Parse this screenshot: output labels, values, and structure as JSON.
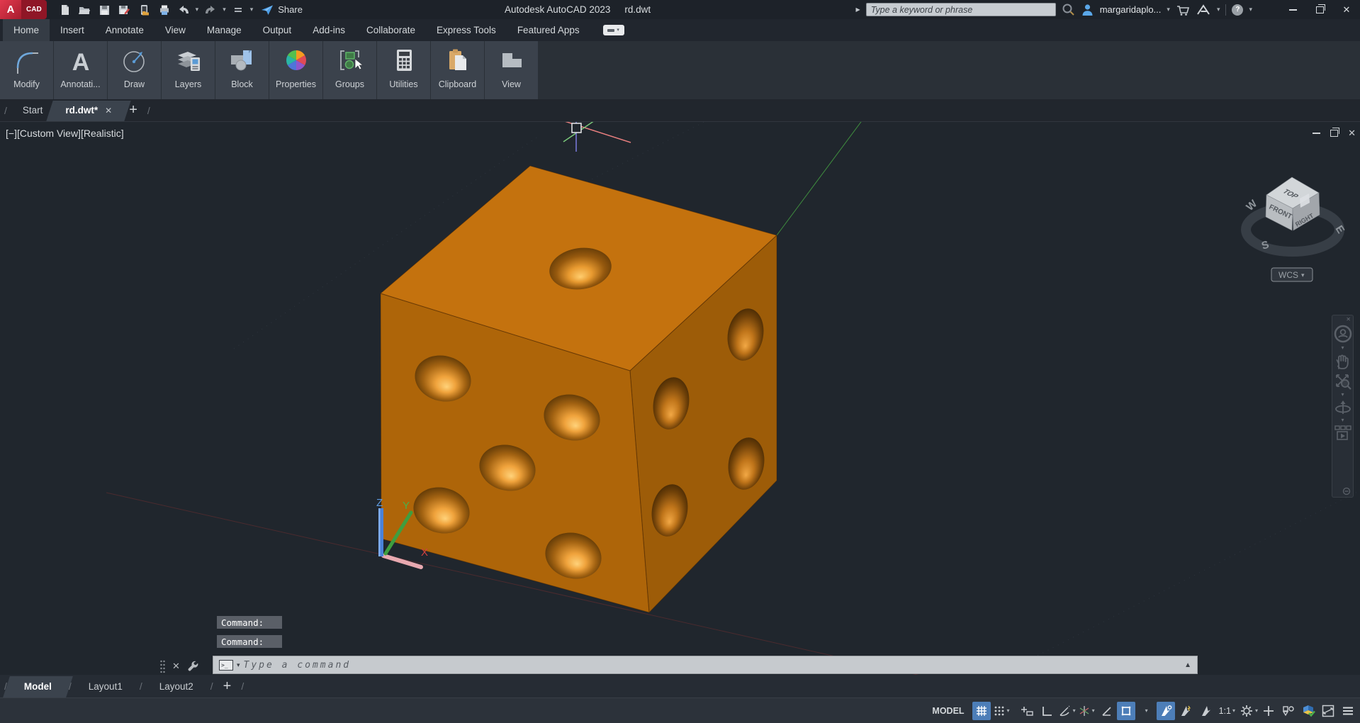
{
  "colors": {
    "accent_blue": "#4d7eb8",
    "logo_red": "#c21b2f",
    "dice_top": "#c4720e",
    "dice_front": "#ae6509",
    "dice_right": "#9d5c08",
    "canvas_bg": "#20262d",
    "command_bar_bg": "#c6cace",
    "viewcube_gray": "#c9cdd0"
  },
  "title_bar": {
    "logo_a": "A",
    "logo_cad": "CAD",
    "share_label": "Share",
    "app_title": "Autodesk AutoCAD 2023",
    "doc_title": "rd.dwt",
    "search_placeholder": "Type a keyword or phrase",
    "username": "margaridaplo...",
    "help_q": "?"
  },
  "menu": {
    "items": [
      "Home",
      "Insert",
      "Annotate",
      "View",
      "Manage",
      "Output",
      "Add-ins",
      "Collaborate",
      "Express Tools",
      "Featured Apps"
    ]
  },
  "ribbon": {
    "panels": [
      {
        "label": "Modify"
      },
      {
        "label": "Annotati..."
      },
      {
        "label": "Draw"
      },
      {
        "label": "Layers"
      },
      {
        "label": "Block"
      },
      {
        "label": "Properties"
      },
      {
        "label": "Groups"
      },
      {
        "label": "Utilities"
      },
      {
        "label": "Clipboard"
      },
      {
        "label": "View"
      }
    ]
  },
  "file_tabs": {
    "start_label": "Start",
    "doc_label": "rd.dwt*"
  },
  "viewport": {
    "label": "[−][Custom View][Realistic]",
    "viewcube": {
      "top": "TOP",
      "front": "FRONT",
      "right": "RIGHT",
      "west": "W",
      "south": "S",
      "east": "E",
      "wcs_label": "WCS"
    },
    "ucs": {
      "x": "X",
      "y": "Y",
      "z": "Z"
    }
  },
  "command": {
    "history": [
      "Command:",
      "Command:"
    ],
    "placeholder": "Type a command"
  },
  "layout_tabs": {
    "model": "Model",
    "layout1": "Layout1",
    "layout2": "Layout2"
  },
  "status_bar": {
    "model_label": "MODEL",
    "scale_label": "1:1"
  },
  "glyphs": {
    "caret_down": "▾",
    "plus": "+",
    "close": "✕",
    "slash": "/",
    "up_arrow": "▲",
    "play": "▶",
    "minimize": "−",
    "annotate_a": "A",
    "prompt": ">_"
  }
}
